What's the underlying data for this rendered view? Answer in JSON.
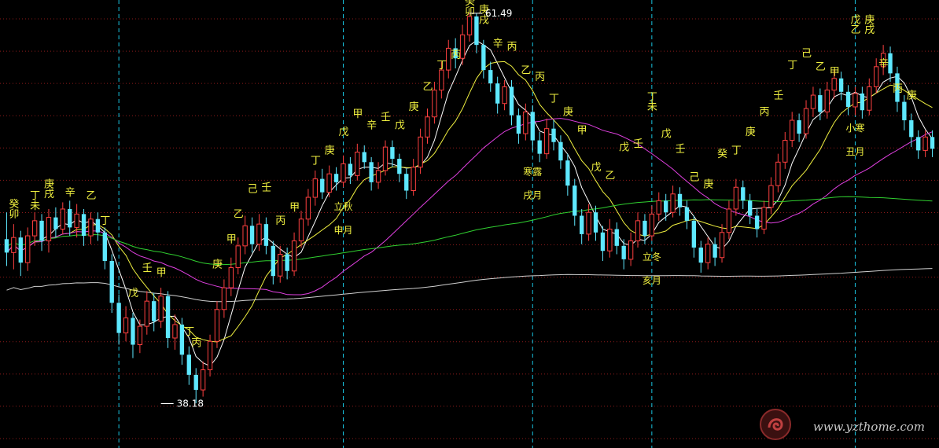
{
  "chart_data": {
    "type": "candlestick",
    "colors": {
      "background": "#000000",
      "grid": "#8b1a1a",
      "vertical_marker": "#19c4e0",
      "up": "#ff4040",
      "down": "#5ee8ff",
      "ma_short": "#ffffff",
      "ma_mid": "#f0f040",
      "ma_long": "#e040e0",
      "ma_longer": "#30d030",
      "ma_longest": "#d0d0d0",
      "label": "#f0f040",
      "price_label": "#ffffff",
      "term_label": "#f0f040"
    },
    "y_range": [
      36,
      62
    ],
    "candles": [
      [
        48,
        47.2,
        49.6,
        46.4
      ],
      [
        47.2,
        48.1,
        48.9,
        46.2
      ],
      [
        48.1,
        46.6,
        48.5,
        45.8
      ],
      [
        46.6,
        48.2,
        48.7,
        46.1
      ],
      [
        48.2,
        49.1,
        49.6,
        47.6
      ],
      [
        49.1,
        47.9,
        49.5,
        47.3
      ],
      [
        47.9,
        49.3,
        49.8,
        47.2
      ],
      [
        49.3,
        48.6,
        49.9,
        48.1
      ],
      [
        48.6,
        49.8,
        50.2,
        48.3
      ],
      [
        49.8,
        48.7,
        50.3,
        48.2
      ],
      [
        48.7,
        49.5,
        50.1,
        48.1
      ],
      [
        49.5,
        48.2,
        49.8,
        47.6
      ],
      [
        48.2,
        49.2,
        49.6,
        47.7
      ],
      [
        49.2,
        48.4,
        49.6,
        47.9
      ],
      [
        48.4,
        46.7,
        48.7,
        46.2
      ],
      [
        46.7,
        44.2,
        47.1,
        43.6
      ],
      [
        44.2,
        42.4,
        44.7,
        41.7
      ],
      [
        42.4,
        43.3,
        44,
        41.9
      ],
      [
        43.3,
        41.7,
        43.6,
        40.9
      ],
      [
        41.7,
        42.8,
        43.2,
        41.2
      ],
      [
        42.8,
        44.3,
        44.9,
        42.3
      ],
      [
        44.3,
        43.1,
        44.8,
        42.5
      ],
      [
        43.1,
        44.6,
        45.1,
        42.7
      ],
      [
        44.6,
        42.1,
        44.9,
        41.5
      ],
      [
        42.1,
        42.9,
        43.5,
        41.4
      ],
      [
        42.9,
        41.1,
        43.3,
        40.5
      ],
      [
        41.1,
        39.9,
        41.6,
        39.3
      ],
      [
        39.9,
        39,
        40.3,
        38.2
      ],
      [
        39,
        40.2,
        40.7,
        38.6
      ],
      [
        40.2,
        41.9,
        42.3,
        39.8
      ],
      [
        41.9,
        43.8,
        44.3,
        41.5
      ],
      [
        43.8,
        45.1,
        45.6,
        43.3
      ],
      [
        45.1,
        46.3,
        46.9,
        44.6
      ],
      [
        46.3,
        47.6,
        48.1,
        45.9
      ],
      [
        47.6,
        48.8,
        49.4,
        47.1
      ],
      [
        48.8,
        47.7,
        49.3,
        47.2
      ],
      [
        47.7,
        48.9,
        49.5,
        47.3
      ],
      [
        48.9,
        47.6,
        49.3,
        47.1
      ],
      [
        47.6,
        45.8,
        47.9,
        45.3
      ],
      [
        45.8,
        47.1,
        47.6,
        45.4
      ],
      [
        47.1,
        46.1,
        47.5,
        45.6
      ],
      [
        46.1,
        47.9,
        48.4,
        45.8
      ],
      [
        47.9,
        49.2,
        49.7,
        47.5
      ],
      [
        49.2,
        50.5,
        51,
        48.8
      ],
      [
        50.5,
        51.6,
        52.1,
        50
      ],
      [
        51.6,
        50.8,
        52.2,
        50.4
      ],
      [
        50.8,
        51.9,
        52.4,
        50.5
      ],
      [
        51.9,
        51.4,
        52.3,
        50.9
      ],
      [
        51.4,
        52.5,
        53,
        51.1
      ],
      [
        52.5,
        51.8,
        52.9,
        51.3
      ],
      [
        51.8,
        53.2,
        53.7,
        51.5
      ],
      [
        53.2,
        52.6,
        53.6,
        52.2
      ],
      [
        52.6,
        51.4,
        52.9,
        50.9
      ],
      [
        51.4,
        52.1,
        52.6,
        51
      ],
      [
        52.1,
        53.5,
        53.9,
        51.8
      ],
      [
        53.5,
        52.8,
        53.9,
        52.3
      ],
      [
        52.8,
        51.9,
        53.1,
        51.4
      ],
      [
        51.9,
        50.9,
        52.2,
        50.4
      ],
      [
        50.9,
        52.3,
        52.8,
        50.6
      ],
      [
        52.3,
        54.1,
        54.6,
        51.9
      ],
      [
        54.1,
        55.3,
        55.8,
        53.7
      ],
      [
        55.3,
        56.9,
        57.4,
        54.9
      ],
      [
        56.9,
        58.1,
        58.6,
        56.4
      ],
      [
        58.1,
        59.4,
        59.9,
        57.6
      ],
      [
        59.4,
        58.8,
        60,
        58.2
      ],
      [
        58.8,
        60.2,
        60.8,
        58.4
      ],
      [
        60.2,
        61.3,
        61.5,
        59.8
      ],
      [
        61.3,
        59.6,
        61.5,
        59.1
      ],
      [
        59.6,
        58.1,
        59.9,
        57.6
      ],
      [
        58.1,
        57.3,
        58.6,
        56.8
      ],
      [
        57.3,
        56.1,
        57.7,
        55.5
      ],
      [
        56.1,
        57.1,
        57.5,
        55.7
      ],
      [
        57.1,
        55.4,
        57.5,
        54.8
      ],
      [
        55.4,
        54.3,
        55.8,
        53.7
      ],
      [
        54.3,
        55.6,
        56.1,
        53.9
      ],
      [
        55.6,
        53.9,
        56,
        53.3
      ],
      [
        53.9,
        53.1,
        54.4,
        52.6
      ],
      [
        53.1,
        54.6,
        55.2,
        52.8
      ],
      [
        54.6,
        53.8,
        55.1,
        53.3
      ],
      [
        53.8,
        52.7,
        54.2,
        52.2
      ],
      [
        52.7,
        51.2,
        53.1,
        50.6
      ],
      [
        51.2,
        49.4,
        51.6,
        48.8
      ],
      [
        49.4,
        48.3,
        49.8,
        47.7
      ],
      [
        48.3,
        49.6,
        50.1,
        47.9
      ],
      [
        49.6,
        48.4,
        50,
        47.9
      ],
      [
        48.4,
        47.3,
        48.8,
        46.7
      ],
      [
        47.3,
        48.6,
        49.2,
        46.9
      ],
      [
        48.6,
        47.6,
        49,
        47.1
      ],
      [
        47.6,
        46.8,
        48,
        46.2
      ],
      [
        46.8,
        47.9,
        48.4,
        46.4
      ],
      [
        47.9,
        49.1,
        49.6,
        47.5
      ],
      [
        49.1,
        48.2,
        49.5,
        47.7
      ],
      [
        48.2,
        49.5,
        50,
        47.9
      ],
      [
        49.5,
        50.3,
        50.8,
        49.1
      ],
      [
        50.3,
        49.6,
        50.7,
        49.1
      ],
      [
        49.6,
        50.7,
        51.2,
        49.3
      ],
      [
        50.7,
        49.9,
        51.1,
        49.4
      ],
      [
        49.9,
        49.1,
        50.3,
        48.6
      ],
      [
        49.1,
        47.5,
        49.4,
        46.9
      ],
      [
        47.5,
        46.6,
        47.9,
        46
      ],
      [
        46.6,
        47.7,
        48.1,
        46.2
      ],
      [
        47.7,
        46.9,
        48.1,
        46.4
      ],
      [
        46.9,
        48.4,
        48.9,
        46.6
      ],
      [
        48.4,
        49.8,
        50.3,
        48
      ],
      [
        49.8,
        51.1,
        51.6,
        49.4
      ],
      [
        51.1,
        50.3,
        51.5,
        49.8
      ],
      [
        50.3,
        49.4,
        50.7,
        48.9
      ],
      [
        49.4,
        48.6,
        49.8,
        48.1
      ],
      [
        48.6,
        49.9,
        50.3,
        48.3
      ],
      [
        49.9,
        51.2,
        51.7,
        49.5
      ],
      [
        51.2,
        52.6,
        53.1,
        50.8
      ],
      [
        52.6,
        53.9,
        54.4,
        52.2
      ],
      [
        53.9,
        55.1,
        55.6,
        53.5
      ],
      [
        55.1,
        54.3,
        55.5,
        53.8
      ],
      [
        54.3,
        55.8,
        56.3,
        54
      ],
      [
        55.8,
        56.6,
        57.1,
        55.3
      ],
      [
        56.6,
        55.6,
        57,
        55.1
      ],
      [
        55.6,
        56.9,
        57.4,
        55.2
      ],
      [
        56.9,
        57.6,
        58.1,
        56.4
      ],
      [
        57.6,
        56.8,
        58,
        56.3
      ],
      [
        56.8,
        55.9,
        57.2,
        55.4
      ],
      [
        55.9,
        56.7,
        57.1,
        55.4
      ],
      [
        56.7,
        55.7,
        57.1,
        55.2
      ],
      [
        55.7,
        57.1,
        57.6,
        55.4
      ],
      [
        57.1,
        58.3,
        58.8,
        56.7
      ],
      [
        58.3,
        59.1,
        59.6,
        57.8
      ],
      [
        59.1,
        57.9,
        59.5,
        57.4
      ],
      [
        57.9,
        56.2,
        58.3,
        55.6
      ],
      [
        56.2,
        55.1,
        56.6,
        54.5
      ],
      [
        55.1,
        54.1,
        55.5,
        53.5
      ],
      [
        54.1,
        53.3,
        54.5,
        52.8
      ],
      [
        53.3,
        54.1,
        54.5,
        52.9
      ],
      [
        54.1,
        53.4,
        54.5,
        52.9
      ]
    ],
    "labels": [
      {
        "i": 1,
        "text": "癸",
        "y": 49.9
      },
      {
        "i": 1,
        "text": "卯",
        "y": 49.3
      },
      {
        "i": 4,
        "text": "丁",
        "y": 50.4
      },
      {
        "i": 4,
        "text": "未",
        "y": 49.8
      },
      {
        "i": 6,
        "text": "庚",
        "y": 51.1
      },
      {
        "i": 6,
        "text": "戌",
        "y": 50.5
      },
      {
        "i": 9,
        "text": "辛",
        "y": 50.6
      },
      {
        "i": 12,
        "text": "乙",
        "y": 50.4
      },
      {
        "i": 14,
        "text": "丁",
        "y": 48.9
      },
      {
        "i": 18,
        "text": "戊",
        "y": 44.6
      },
      {
        "i": 20,
        "text": "壬",
        "y": 46.1
      },
      {
        "i": 22,
        "text": "甲",
        "y": 45.8
      },
      {
        "i": 26,
        "text": "丁",
        "y": 42.3
      },
      {
        "i": 27,
        "text": "丙",
        "y": 41.6
      },
      {
        "i": 30,
        "text": "庚",
        "y": 46.3
      },
      {
        "i": 32,
        "text": "甲",
        "y": 47.8
      },
      {
        "i": 33,
        "text": "乙",
        "y": 49.3
      },
      {
        "i": 35,
        "text": "己",
        "y": 50.8
      },
      {
        "i": 37,
        "text": "壬",
        "y": 50.9
      },
      {
        "i": 39,
        "text": "丙",
        "y": 48.9
      },
      {
        "i": 41,
        "text": "甲",
        "y": 49.7
      },
      {
        "i": 44,
        "text": "丁",
        "y": 52.5
      },
      {
        "i": 46,
        "text": "庚",
        "y": 53.1
      },
      {
        "i": 48,
        "text": "戊",
        "y": 54.2
      },
      {
        "i": 50,
        "text": "甲",
        "y": 55.3
      },
      {
        "i": 52,
        "text": "辛",
        "y": 54.6
      },
      {
        "i": 54,
        "text": "壬",
        "y": 55.1
      },
      {
        "i": 56,
        "text": "戊",
        "y": 54.6
      },
      {
        "i": 58,
        "text": "庚",
        "y": 55.7
      },
      {
        "i": 60,
        "text": "乙",
        "y": 56.9
      },
      {
        "i": 62,
        "text": "丁",
        "y": 58.2
      },
      {
        "i": 64,
        "text": "丙",
        "y": 58.8
      },
      {
        "i": 66,
        "text": "癸",
        "y": 62
      },
      {
        "i": 66,
        "text": "卯",
        "y": 61.4
      },
      {
        "i": 68,
        "text": "庚",
        "y": 61.5
      },
      {
        "i": 68,
        "text": "戌",
        "y": 60.9
      },
      {
        "i": 70,
        "text": "辛",
        "y": 59.5
      },
      {
        "i": 72,
        "text": "丙",
        "y": 59.3
      },
      {
        "i": 74,
        "text": "乙",
        "y": 57.9
      },
      {
        "i": 76,
        "text": "丙",
        "y": 57.5
      },
      {
        "i": 78,
        "text": "丁",
        "y": 56.2
      },
      {
        "i": 80,
        "text": "庚",
        "y": 55.4
      },
      {
        "i": 82,
        "text": "甲",
        "y": 54.3
      },
      {
        "i": 84,
        "text": "戊",
        "y": 52.1
      },
      {
        "i": 86,
        "text": "乙",
        "y": 51.6
      },
      {
        "i": 88,
        "text": "戊",
        "y": 53.3
      },
      {
        "i": 90,
        "text": "壬",
        "y": 53.5
      },
      {
        "i": 92,
        "text": "丁",
        "y": 56.3
      },
      {
        "i": 92,
        "text": "未",
        "y": 55.7
      },
      {
        "i": 94,
        "text": "戊",
        "y": 54.1
      },
      {
        "i": 96,
        "text": "壬",
        "y": 53.2
      },
      {
        "i": 98,
        "text": "己",
        "y": 51.5
      },
      {
        "i": 100,
        "text": "庚",
        "y": 51.1
      },
      {
        "i": 102,
        "text": "癸",
        "y": 52.9
      },
      {
        "i": 104,
        "text": "丁",
        "y": 53.1
      },
      {
        "i": 106,
        "text": "庚",
        "y": 54.2
      },
      {
        "i": 108,
        "text": "丙",
        "y": 55.4
      },
      {
        "i": 110,
        "text": "壬",
        "y": 56.4
      },
      {
        "i": 112,
        "text": "丁",
        "y": 58.2
      },
      {
        "i": 114,
        "text": "己",
        "y": 58.9
      },
      {
        "i": 116,
        "text": "乙",
        "y": 58.1
      },
      {
        "i": 118,
        "text": "甲",
        "y": 57.8
      },
      {
        "i": 121,
        "text": "戊",
        "y": 60.9
      },
      {
        "i": 121,
        "text": "乙",
        "y": 60.3
      },
      {
        "i": 123,
        "text": "庚",
        "y": 60.9
      },
      {
        "i": 123,
        "text": "戌",
        "y": 60.3
      },
      {
        "i": 125,
        "text": "辛",
        "y": 58.3
      },
      {
        "i": 127,
        "text": "丙",
        "y": 56.8
      },
      {
        "i": 129,
        "text": "庚",
        "y": 56.4
      }
    ],
    "term_markers": [
      {
        "i": 16,
        "name": "",
        "month": ""
      },
      {
        "i": 48,
        "name": "立秋",
        "month": "申月"
      },
      {
        "i": 75,
        "name": "寒露",
        "month": "戌月"
      },
      {
        "i": 92,
        "name": "立冬",
        "month": "亥月"
      },
      {
        "i": 121,
        "name": "小寒",
        "month": "丑月"
      }
    ],
    "price_labels": [
      {
        "i": 66,
        "text": "61.49",
        "y": 61.49,
        "align": "right"
      },
      {
        "i": 22,
        "text": "38.18",
        "y": 38.18,
        "align": "right"
      }
    ]
  },
  "watermark": {
    "text": "www.yzthome.com"
  }
}
